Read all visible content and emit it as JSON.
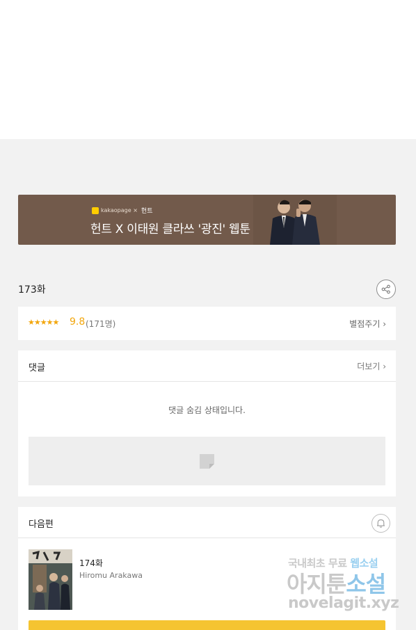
{
  "banner": {
    "brand_small": "kakaopage ×",
    "brand_hunt": "헌트",
    "title": "헌트 X 이태원 클라쓰 '광진' 웹툰"
  },
  "episode": {
    "title": "173화"
  },
  "rating": {
    "stars": "★★★★★",
    "score": "9.8",
    "count": "(171명)",
    "rate_link": "별점주기 ›"
  },
  "comments": {
    "title": "댓글",
    "more": "더보기 ›",
    "hidden_text": "댓글 숨김 상태입니다."
  },
  "next": {
    "title": "다음편",
    "episode": "174화",
    "author": "Hiromu Arakawa"
  },
  "watermark": {
    "line1_a": "국내최초 무료",
    "line1_b": "웹소설",
    "line2_a": "아지툰",
    "line2_b": "소설",
    "line3": "novelagit.xyz"
  },
  "colors": {
    "banner_bg": "#725a4b",
    "accent_star": "#f2a60c",
    "button_yellow": "#f5c431"
  }
}
